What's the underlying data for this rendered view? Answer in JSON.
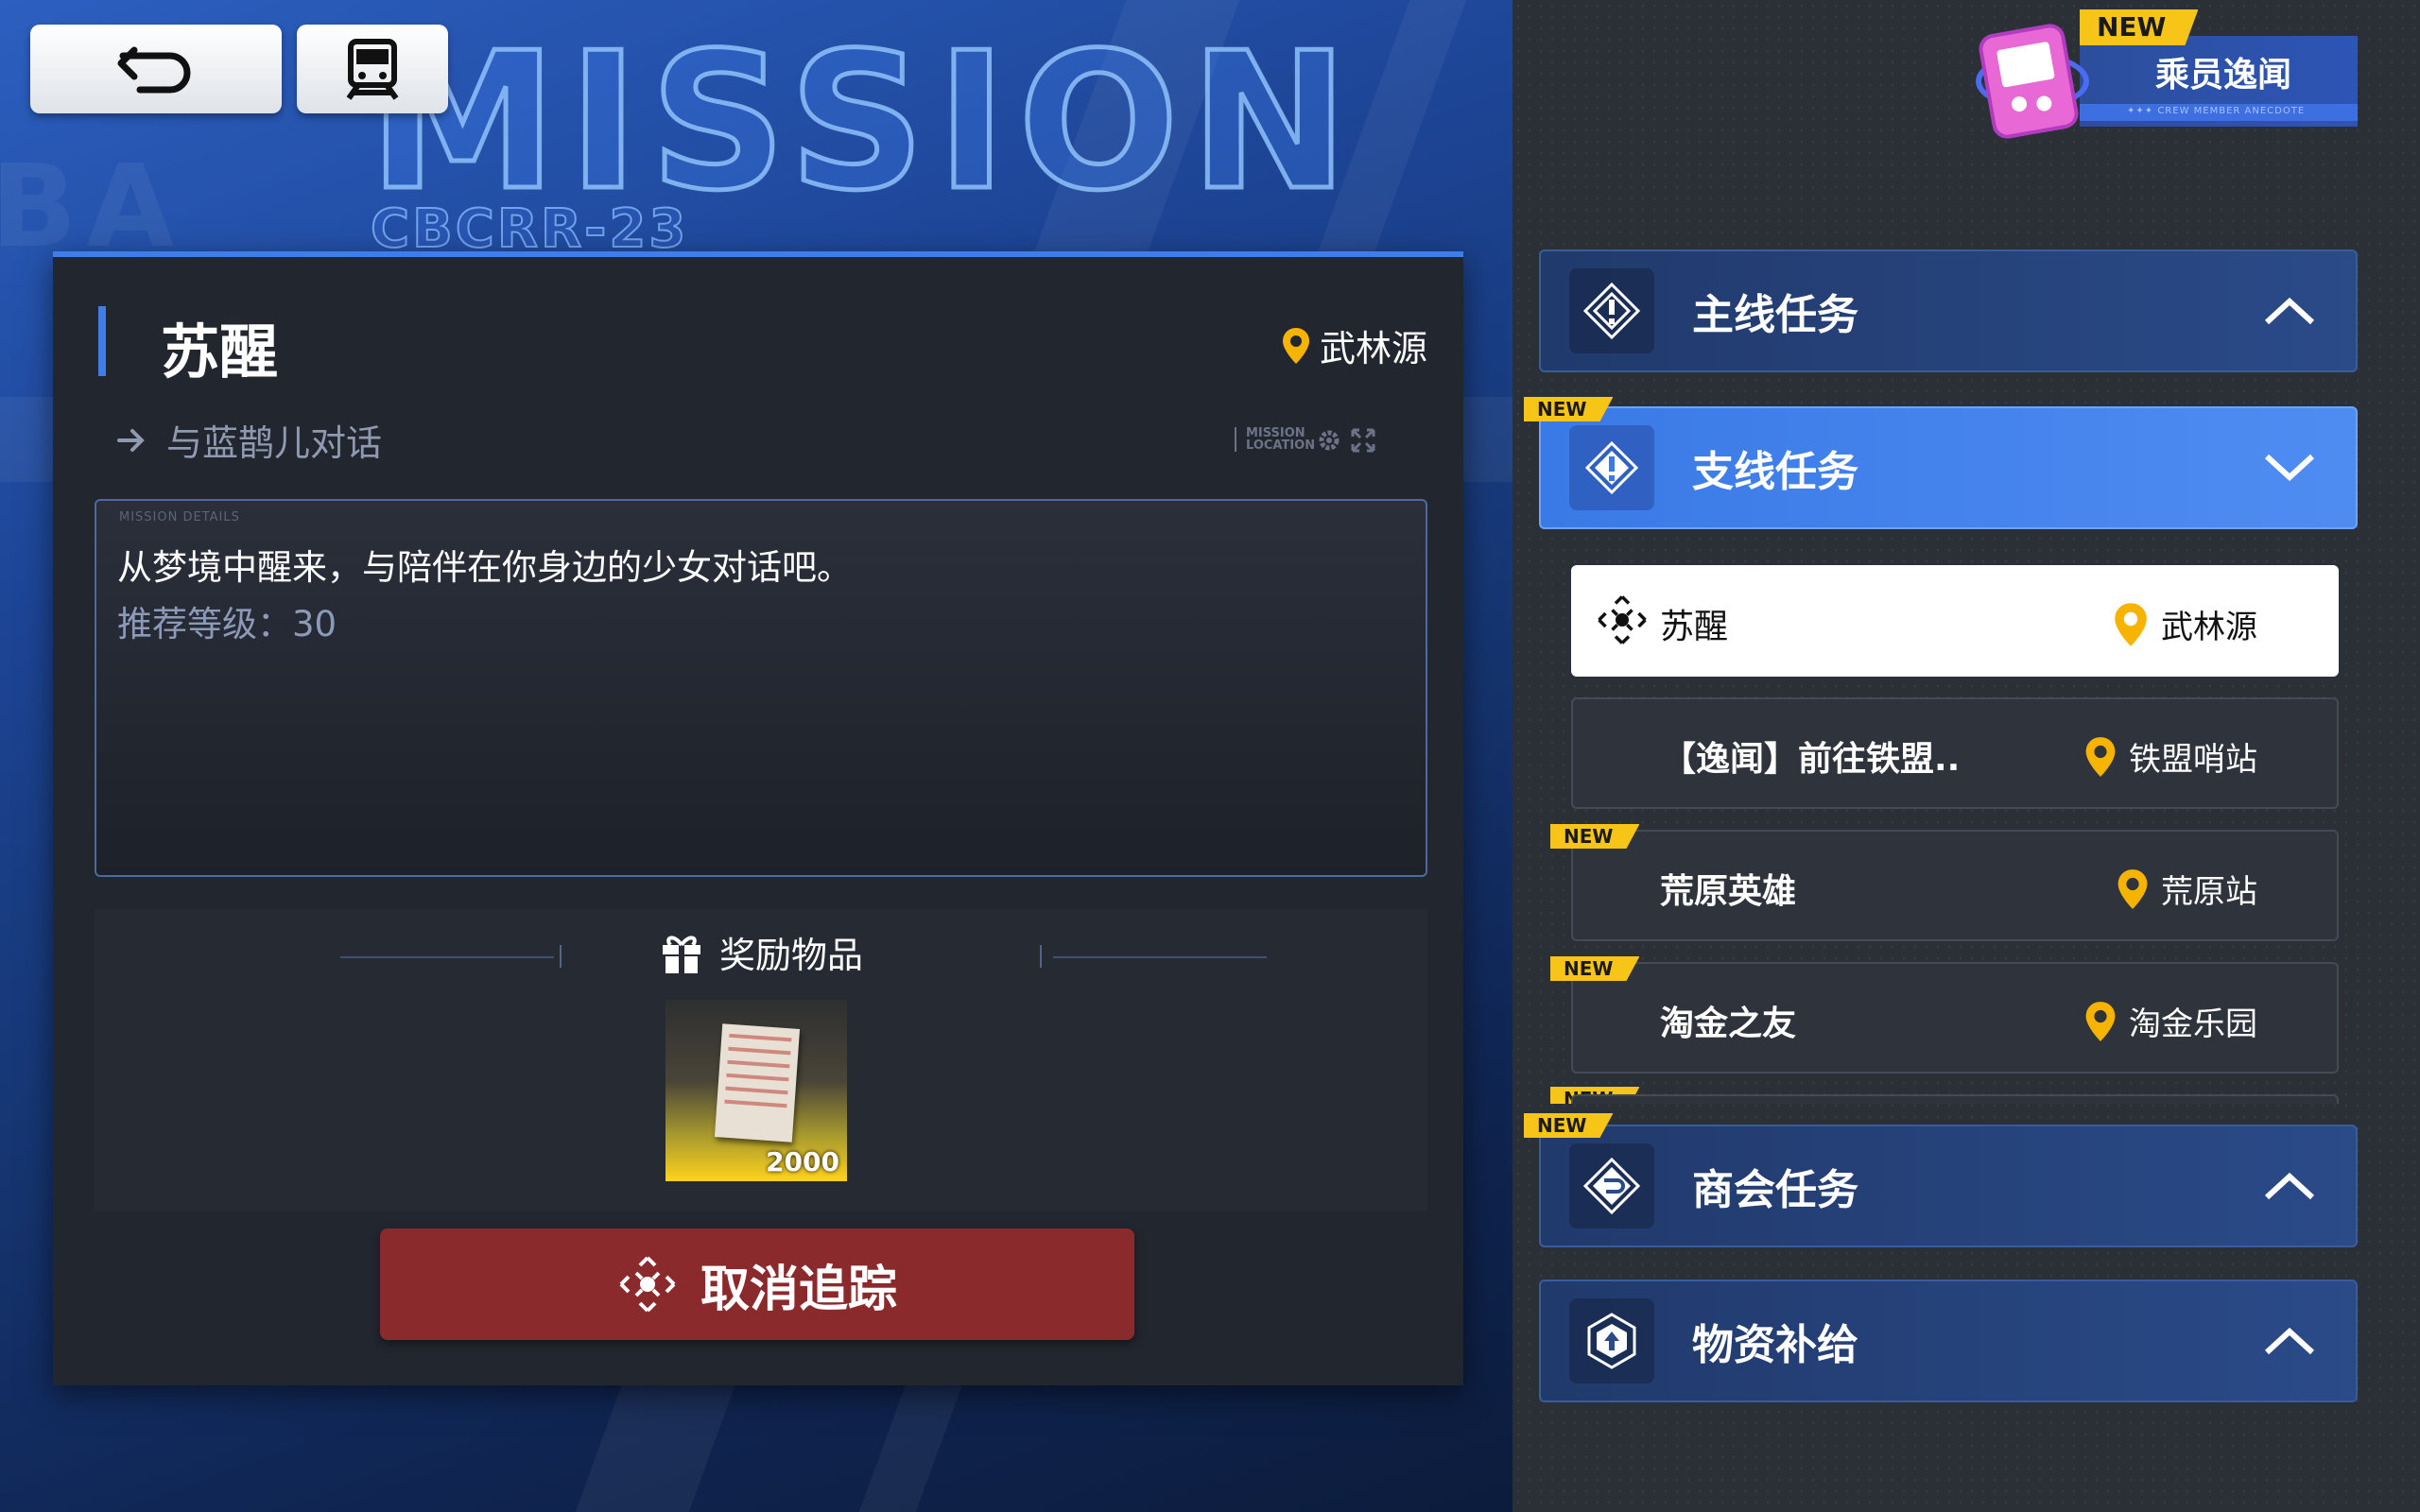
{
  "header": {
    "back_icon": "undo-arrow-icon",
    "train_icon": "train-icon",
    "bg_title": "MISSION",
    "bg_code": "CBCRR-23"
  },
  "detail": {
    "title": "苏醒",
    "location": "武林源",
    "objective": "与蓝鹊儿对话",
    "location_tag": "MISSION LOCATION",
    "details_caption": "MISSION DETAILS",
    "description": "从梦境中醒来，与陪伴在你身边的少女对话吧。",
    "recommended_level": "推荐等级：30",
    "reward_header": "奖励物品",
    "reward_quantity": "2000",
    "cancel_label": "取消追踪"
  },
  "crew": {
    "new_label": "NEW",
    "label": "乘员逸闻",
    "sub": "✦✦✦  CREW MEMBER ANECDOTE"
  },
  "categories": {
    "main": {
      "label": "主线任务"
    },
    "side": {
      "label": "支线任务",
      "new_label": "NEW"
    },
    "guild": {
      "label": "商会任务",
      "new_label": "NEW"
    },
    "supply": {
      "label": "物资补给"
    }
  },
  "tasks": [
    {
      "name": "苏醒",
      "location": "武林源",
      "new_label": ""
    },
    {
      "name": "【逸闻】前往铁盟..",
      "location": "铁盟哨站",
      "new_label": ""
    },
    {
      "name": "荒原英雄",
      "location": "荒原站",
      "new_label": "NEW"
    },
    {
      "name": "淘金之友",
      "location": "淘金乐园",
      "new_label": "NEW"
    },
    {
      "name": "",
      "location": "",
      "new_label": "NEW"
    }
  ],
  "colors": {
    "accent_blue": "#3f7ee8",
    "cancel_red": "#8a2a2c",
    "new_yellow": "#f6c517",
    "pin_yellow": "#f6b400"
  }
}
